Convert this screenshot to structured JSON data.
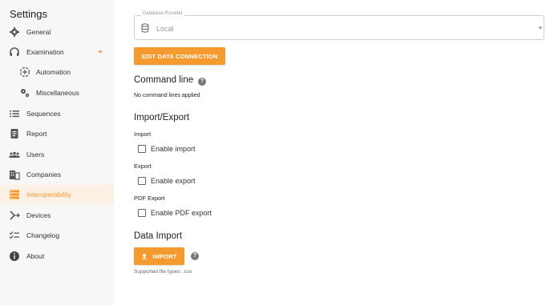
{
  "sidebar": {
    "title": "Settings",
    "items": [
      {
        "label": "General",
        "icon": "gear-icon"
      },
      {
        "label": "Examination",
        "icon": "headset-icon"
      },
      {
        "label": "Automation",
        "icon": "automation-icon"
      },
      {
        "label": "Miscellaneous",
        "icon": "gears-icon"
      },
      {
        "label": "Sequences",
        "icon": "list-icon"
      },
      {
        "label": "Report",
        "icon": "report-icon"
      },
      {
        "label": "Users",
        "icon": "users-icon"
      },
      {
        "label": "Companies",
        "icon": "companies-icon"
      },
      {
        "label": "Interoperability",
        "icon": "interoperability-icon"
      },
      {
        "label": "Devices",
        "icon": "devices-icon"
      },
      {
        "label": "Changelog",
        "icon": "changelog-icon"
      },
      {
        "label": "About",
        "icon": "info-icon"
      }
    ],
    "active_index": 8
  },
  "main": {
    "provider": {
      "legend": "Database Provider",
      "value": "Local"
    },
    "edit_button": "EDIT DATA CONNECTION",
    "command_line": {
      "title": "Command line",
      "status": "No command lines applied"
    },
    "import_export": {
      "title": "Import/Export",
      "import_label": "Import",
      "import_checkbox": "Enable import",
      "export_label": "Export",
      "export_checkbox": "Enable export",
      "pdf_label": "PDF Export",
      "pdf_checkbox": "Enable PDF export"
    },
    "data_import": {
      "title": "Data Import",
      "button": "IMPORT",
      "supported": "Supported file types: .csv"
    }
  },
  "colors": {
    "accent": "#f59a2f",
    "active_bg": "#fdf1e5"
  }
}
